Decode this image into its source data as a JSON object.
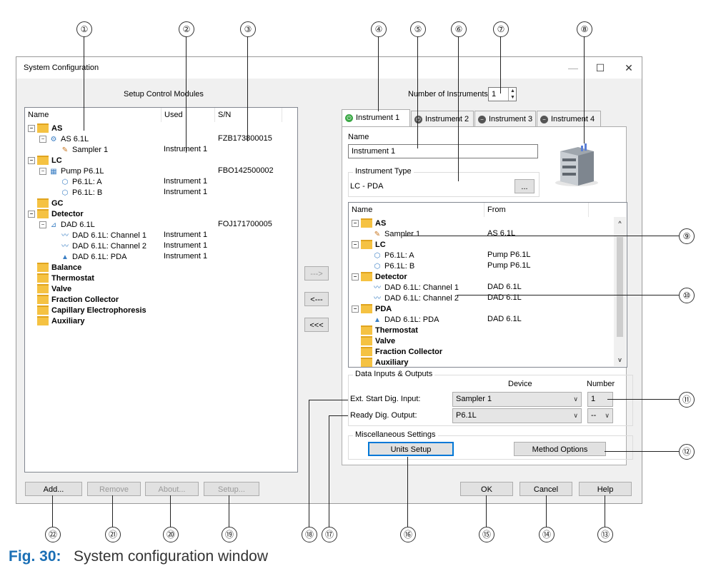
{
  "callouts": [
    "①",
    "②",
    "③",
    "④",
    "⑤",
    "⑥",
    "⑦",
    "⑧",
    "⑨",
    "⑩",
    "⑪",
    "⑫",
    "⑬",
    "⑭",
    "⑮",
    "⑯",
    "⑰",
    "⑱",
    "⑲",
    "⑳",
    "㉑",
    "㉒"
  ],
  "window": {
    "title": "System Configuration",
    "minimize": "—",
    "maximize": "☐",
    "close": "✕"
  },
  "left": {
    "heading": "Setup Control Modules",
    "columns": [
      "Name",
      "Used",
      "S/N"
    ],
    "tree": [
      {
        "label": "AS",
        "used": "",
        "sn": ""
      },
      {
        "label": "AS 6.1L",
        "used": "",
        "sn": "FZB173800015"
      },
      {
        "label": "Sampler 1",
        "used": "Instrument 1",
        "sn": ""
      },
      {
        "label": "LC",
        "used": "",
        "sn": ""
      },
      {
        "label": "Pump P6.1L",
        "used": "",
        "sn": "FBO142500002"
      },
      {
        "label": "P6.1L: A",
        "used": "Instrument 1",
        "sn": ""
      },
      {
        "label": "P6.1L: B",
        "used": "Instrument 1",
        "sn": ""
      },
      {
        "label": "GC",
        "used": "",
        "sn": ""
      },
      {
        "label": "Detector",
        "used": "",
        "sn": ""
      },
      {
        "label": "DAD 6.1L",
        "used": "",
        "sn": "FOJ171700005"
      },
      {
        "label": "DAD 6.1L: Channel 1",
        "used": "Instrument 1",
        "sn": ""
      },
      {
        "label": "DAD 6.1L: Channel 2",
        "used": "Instrument 1",
        "sn": ""
      },
      {
        "label": "DAD 6.1L: PDA",
        "used": "Instrument 1",
        "sn": ""
      },
      {
        "label": "Balance",
        "used": "",
        "sn": ""
      },
      {
        "label": "Thermostat",
        "used": "",
        "sn": ""
      },
      {
        "label": "Valve",
        "used": "",
        "sn": ""
      },
      {
        "label": "Fraction Collector",
        "used": "",
        "sn": ""
      },
      {
        "label": "Capillary Electrophoresis",
        "used": "",
        "sn": ""
      },
      {
        "label": "Auxiliary",
        "used": "",
        "sn": ""
      }
    ],
    "buttons": {
      "add": "Add...",
      "remove": "Remove",
      "about": "About...",
      "setup": "Setup..."
    }
  },
  "middle": {
    "add_one": "--->",
    "remove_one": "<---",
    "remove_all": "<<<"
  },
  "right": {
    "num_label": "Number of Instruments:",
    "num_value": "1",
    "tabs": [
      "Instrument 1",
      "Instrument 2",
      "Instrument 3",
      "Instrument 4"
    ],
    "name_label": "Name",
    "name_value": "Instrument 1",
    "type_group": "Instrument Type",
    "type_value": "LC - PDA",
    "type_btn": "...",
    "columns": [
      "Name",
      "From"
    ],
    "tree": [
      {
        "label": "AS",
        "from": ""
      },
      {
        "label": "Sampler 1",
        "from": "AS 6.1L"
      },
      {
        "label": "LC",
        "from": ""
      },
      {
        "label": "P6.1L: A",
        "from": "Pump P6.1L"
      },
      {
        "label": "P6.1L: B",
        "from": "Pump P6.1L"
      },
      {
        "label": "Detector",
        "from": ""
      },
      {
        "label": "DAD 6.1L: Channel 1",
        "from": "DAD 6.1L"
      },
      {
        "label": "DAD 6.1L: Channel 2",
        "from": "DAD 6.1L"
      },
      {
        "label": "PDA",
        "from": ""
      },
      {
        "label": "DAD 6.1L: PDA",
        "from": "DAD 6.1L"
      },
      {
        "label": "Thermostat",
        "from": ""
      },
      {
        "label": "Valve",
        "from": ""
      },
      {
        "label": "Fraction Collector",
        "from": ""
      },
      {
        "label": "Auxiliary",
        "from": ""
      }
    ],
    "io_group": "Data Inputs & Outputs",
    "io_device": "Device",
    "io_number": "Number",
    "ext_label": "Ext. Start Dig. Input:",
    "ext_device": "Sampler 1",
    "ext_number": "1",
    "ready_label": "Ready Dig. Output:",
    "ready_device": "P6.1L",
    "ready_number": "--",
    "misc_group": "Miscellaneous Settings",
    "units_btn": "Units Setup",
    "method_btn": "Method Options"
  },
  "bottom": {
    "ok": "OK",
    "cancel": "Cancel",
    "help": "Help"
  },
  "caption": {
    "fig": "Fig. 30:",
    "text": "System configuration window"
  },
  "colors": {
    "accent": "#1a6fb5",
    "folder": "#f5c242",
    "tab_green": "#3aa845",
    "tab_gray": "#555555"
  }
}
